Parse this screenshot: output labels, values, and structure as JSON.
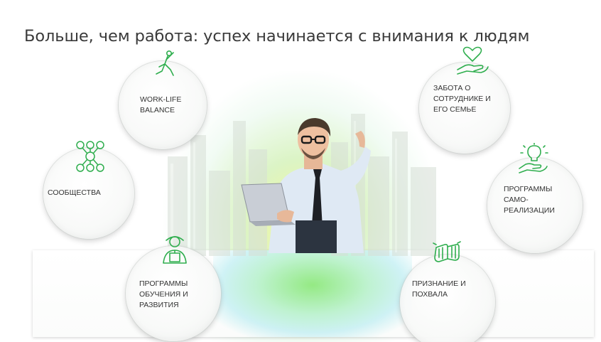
{
  "slide": {
    "title": "Больше, чем работа: успех начинается с внимания к людям"
  },
  "pillars": {
    "work_life": {
      "label": "WORK-LIFE\nBALANCE",
      "icon": "yoga-person-icon"
    },
    "communities": {
      "label": "СООБЩЕСТВА",
      "icon": "community-network-icon"
    },
    "training": {
      "label": "ПРОГРАММЫ\nОБУЧЕНИЯ И\nРАЗВИТИЯ",
      "icon": "teacher-icon"
    },
    "care": {
      "label": "ЗАБОТА О\nСОТРУДНИКЕ И\nЕГО СЕМЬЕ",
      "icon": "heart-hand-icon"
    },
    "self_realization": {
      "label": "ПРОГРАММЫ\nСАМО-\nРЕАЛИЗАЦИИ",
      "icon": "idea-hand-icon"
    },
    "recognition": {
      "label": "ПРИЗНАНИЕ И\nПОХВАЛА",
      "icon": "applause-icon"
    }
  },
  "colors": {
    "accent": "#2fae4e",
    "title_text": "#3a3a3a",
    "label_text": "#333333"
  }
}
